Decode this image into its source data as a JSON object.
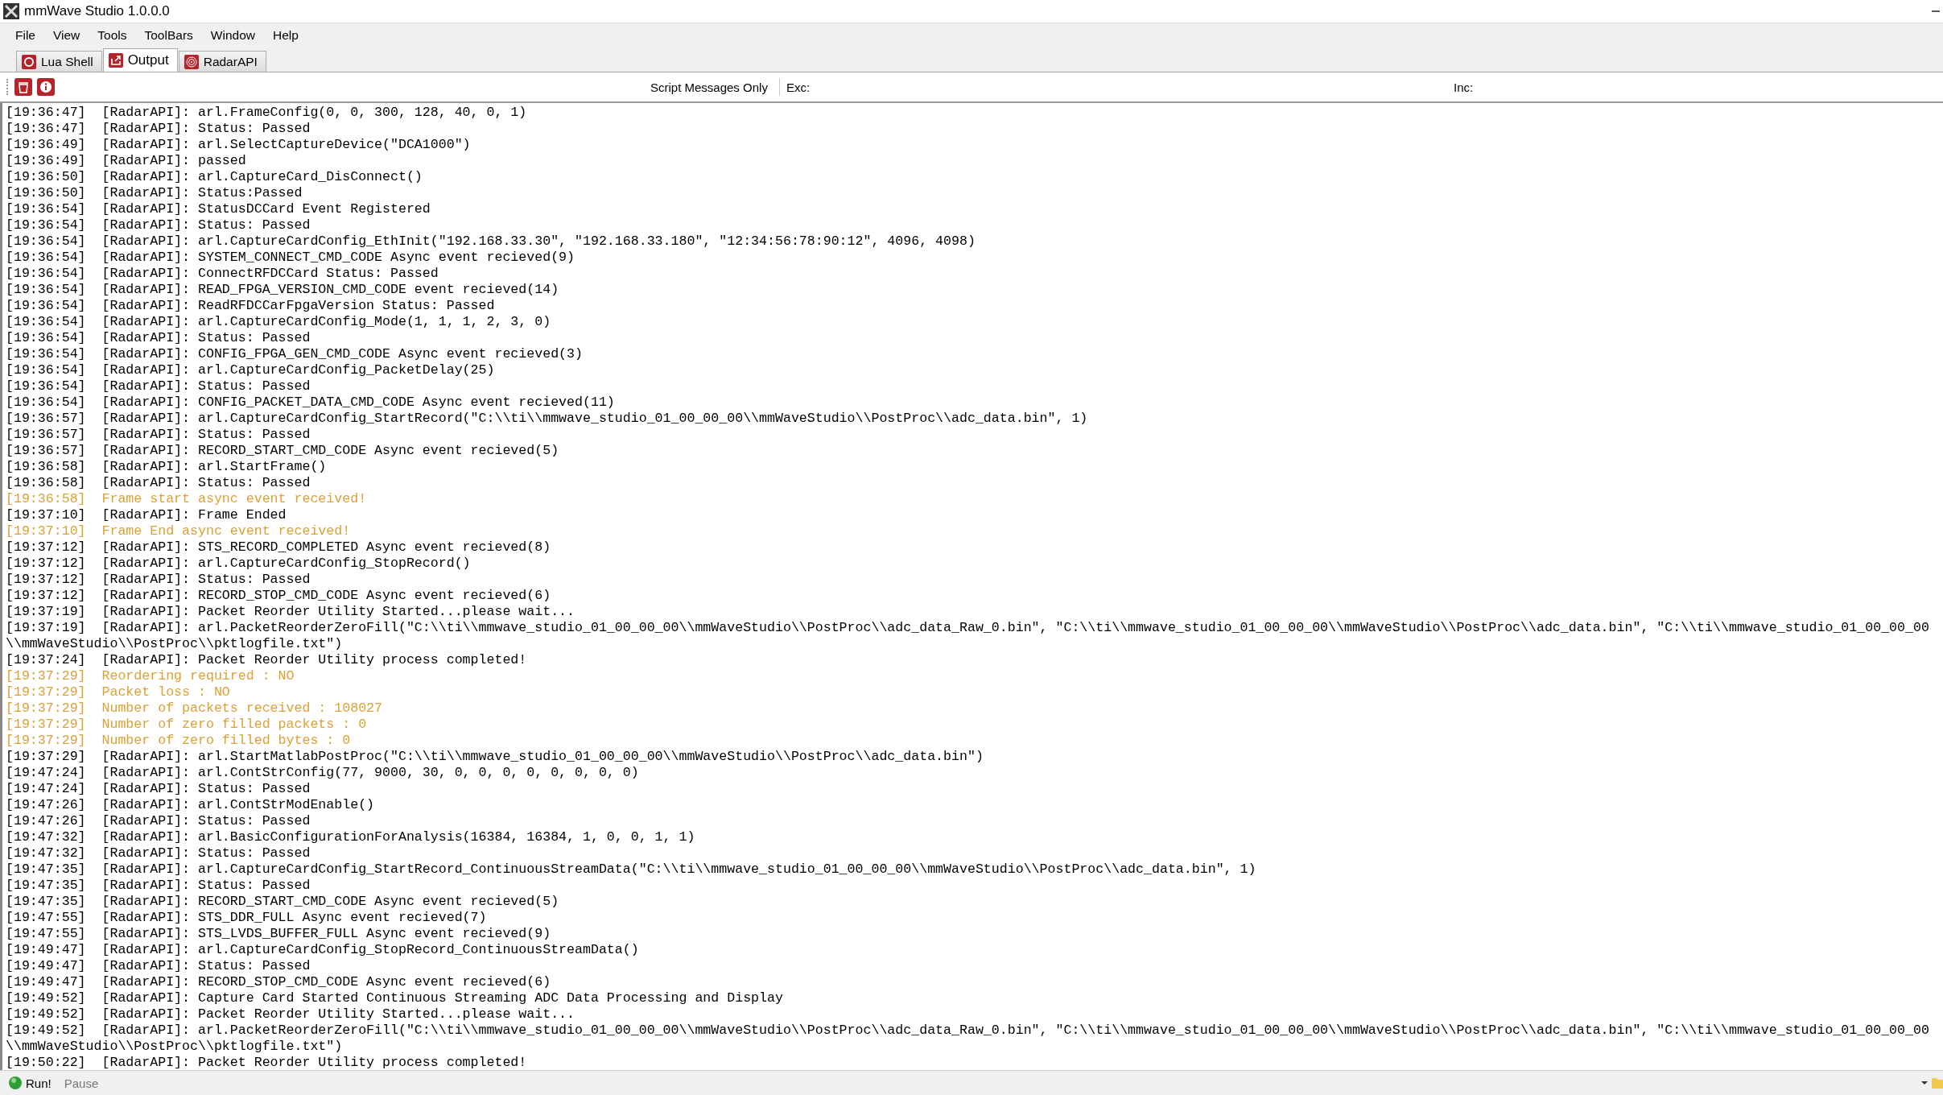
{
  "window": {
    "title": "mmWave Studio 1.0.0.0"
  },
  "menu": [
    "File",
    "View",
    "Tools",
    "ToolBars",
    "Window",
    "Help"
  ],
  "tabs": [
    {
      "label": "Lua Shell",
      "selected": false
    },
    {
      "label": "Output",
      "selected": true
    },
    {
      "label": "RadarAPI",
      "selected": false
    }
  ],
  "toolbar": {
    "filter_button": "Script Messages Only",
    "exclude_label": "Exc:",
    "include_label": "Inc:"
  },
  "log": [
    {
      "time": "[19:36:47]",
      "kind": "api",
      "text": "[RadarAPI]: arl.FrameConfig(0, 0, 300, 128, 40, 0, 1)"
    },
    {
      "time": "[19:36:47]",
      "kind": "api",
      "text": "[RadarAPI]: Status: Passed"
    },
    {
      "time": "[19:36:49]",
      "kind": "api",
      "text": "[RadarAPI]: arl.SelectCaptureDevice(\"DCA1000\")"
    },
    {
      "time": "[19:36:49]",
      "kind": "api",
      "text": "[RadarAPI]: passed"
    },
    {
      "time": "[19:36:50]",
      "kind": "api",
      "text": "[RadarAPI]: arl.CaptureCard_DisConnect()"
    },
    {
      "time": "[19:36:50]",
      "kind": "api",
      "text": "[RadarAPI]: Status:Passed"
    },
    {
      "time": "[19:36:54]",
      "kind": "api",
      "text": "[RadarAPI]: StatusDCCard Event Registered"
    },
    {
      "time": "[19:36:54]",
      "kind": "api",
      "text": "[RadarAPI]: Status: Passed"
    },
    {
      "time": "[19:36:54]",
      "kind": "api",
      "text": "[RadarAPI]: arl.CaptureCardConfig_EthInit(\"192.168.33.30\", \"192.168.33.180\", \"12:34:56:78:90:12\", 4096, 4098)"
    },
    {
      "time": "[19:36:54]",
      "kind": "api",
      "text": "[RadarAPI]: SYSTEM_CONNECT_CMD_CODE Async event recieved(9)"
    },
    {
      "time": "[19:36:54]",
      "kind": "api",
      "text": "[RadarAPI]: ConnectRFDCCard Status: Passed"
    },
    {
      "time": "[19:36:54]",
      "kind": "api",
      "text": "[RadarAPI]: READ_FPGA_VERSION_CMD_CODE event recieved(14)"
    },
    {
      "time": "[19:36:54]",
      "kind": "api",
      "text": "[RadarAPI]: ReadRFDCCarFpgaVersion Status: Passed"
    },
    {
      "time": "[19:36:54]",
      "kind": "api",
      "text": "[RadarAPI]: arl.CaptureCardConfig_Mode(1, 1, 1, 2, 3, 0)"
    },
    {
      "time": "[19:36:54]",
      "kind": "api",
      "text": "[RadarAPI]: Status: Passed"
    },
    {
      "time": "[19:36:54]",
      "kind": "api",
      "text": "[RadarAPI]: CONFIG_FPGA_GEN_CMD_CODE Async event recieved(3)"
    },
    {
      "time": "[19:36:54]",
      "kind": "api",
      "text": "[RadarAPI]: arl.CaptureCardConfig_PacketDelay(25)"
    },
    {
      "time": "[19:36:54]",
      "kind": "api",
      "text": "[RadarAPI]: Status: Passed"
    },
    {
      "time": "[19:36:54]",
      "kind": "api",
      "text": "[RadarAPI]: CONFIG_PACKET_DATA_CMD_CODE Async event recieved(11)"
    },
    {
      "time": "[19:36:57]",
      "kind": "api",
      "text": "[RadarAPI]: arl.CaptureCardConfig_StartRecord(\"C:\\\\ti\\\\mmwave_studio_01_00_00_00\\\\mmWaveStudio\\\\PostProc\\\\adc_data.bin\", 1)"
    },
    {
      "time": "[19:36:57]",
      "kind": "api",
      "text": "[RadarAPI]: Status: Passed"
    },
    {
      "time": "[19:36:57]",
      "kind": "api",
      "text": "[RadarAPI]: RECORD_START_CMD_CODE Async event recieved(5)"
    },
    {
      "time": "[19:36:58]",
      "kind": "api",
      "text": "[RadarAPI]: arl.StartFrame()"
    },
    {
      "time": "[19:36:58]",
      "kind": "api",
      "text": "[RadarAPI]: Status: Passed"
    },
    {
      "time": "[19:36:58]",
      "kind": "event",
      "text": "Frame start async event received!"
    },
    {
      "time": "[19:37:10]",
      "kind": "api",
      "text": "[RadarAPI]: Frame Ended"
    },
    {
      "time": "[19:37:10]",
      "kind": "event",
      "text": "Frame End async event received!"
    },
    {
      "time": "[19:37:12]",
      "kind": "api",
      "text": "[RadarAPI]: STS_RECORD_COMPLETED Async event recieved(8)"
    },
    {
      "time": "[19:37:12]",
      "kind": "api",
      "text": "[RadarAPI]: arl.CaptureCardConfig_StopRecord()"
    },
    {
      "time": "[19:37:12]",
      "kind": "api",
      "text": "[RadarAPI]: Status: Passed"
    },
    {
      "time": "[19:37:12]",
      "kind": "api",
      "text": "[RadarAPI]: RECORD_STOP_CMD_CODE Async event recieved(6)"
    },
    {
      "time": "[19:37:19]",
      "kind": "api",
      "text": "[RadarAPI]: Packet Reorder Utility Started...please wait..."
    },
    {
      "time": "[19:37:19]",
      "kind": "api",
      "text": "[RadarAPI]: arl.PacketReorderZeroFill(\"C:\\\\ti\\\\mmwave_studio_01_00_00_00\\\\mmWaveStudio\\\\PostProc\\\\adc_data_Raw_0.bin\", \"C:\\\\ti\\\\mmwave_studio_01_00_00_00\\\\mmWaveStudio\\\\PostProc\\\\adc_data.bin\", \"C:\\\\ti\\\\mmwave_studio_01_00_00_00\\\\mmWaveStudio\\\\PostProc\\\\pktlogfile.txt\")"
    },
    {
      "time": "[19:37:24]",
      "kind": "api",
      "text": "[RadarAPI]: Packet Reorder Utility process completed!"
    },
    {
      "time": "[19:37:29]",
      "kind": "event",
      "text": "Reordering required : NO"
    },
    {
      "time": "[19:37:29]",
      "kind": "event",
      "text": "Packet loss : NO"
    },
    {
      "time": "[19:37:29]",
      "kind": "event",
      "text": "Number of packets received : 108027"
    },
    {
      "time": "[19:37:29]",
      "kind": "event",
      "text": "Number of zero filled packets : 0"
    },
    {
      "time": "[19:37:29]",
      "kind": "event",
      "text": "Number of zero filled bytes : 0"
    },
    {
      "time": "[19:37:29]",
      "kind": "api",
      "text": "[RadarAPI]: arl.StartMatlabPostProc(\"C:\\\\ti\\\\mmwave_studio_01_00_00_00\\\\mmWaveStudio\\\\PostProc\\\\adc_data.bin\")"
    },
    {
      "time": "[19:47:24]",
      "kind": "api",
      "text": "[RadarAPI]: arl.ContStrConfig(77, 9000, 30, 0, 0, 0, 0, 0, 0, 0, 0)"
    },
    {
      "time": "[19:47:24]",
      "kind": "api",
      "text": "[RadarAPI]: Status: Passed"
    },
    {
      "time": "[19:47:26]",
      "kind": "api",
      "text": "[RadarAPI]: arl.ContStrModEnable()"
    },
    {
      "time": "[19:47:26]",
      "kind": "api",
      "text": "[RadarAPI]: Status: Passed"
    },
    {
      "time": "[19:47:32]",
      "kind": "api",
      "text": "[RadarAPI]: arl.BasicConfigurationForAnalysis(16384, 16384, 1, 0, 0, 1, 1)"
    },
    {
      "time": "[19:47:32]",
      "kind": "api",
      "text": "[RadarAPI]: Status: Passed"
    },
    {
      "time": "[19:47:35]",
      "kind": "api",
      "text": "[RadarAPI]: arl.CaptureCardConfig_StartRecord_ContinuousStreamData(\"C:\\\\ti\\\\mmwave_studio_01_00_00_00\\\\mmWaveStudio\\\\PostProc\\\\adc_data.bin\", 1)"
    },
    {
      "time": "[19:47:35]",
      "kind": "api",
      "text": "[RadarAPI]: Status: Passed"
    },
    {
      "time": "[19:47:35]",
      "kind": "api",
      "text": "[RadarAPI]: RECORD_START_CMD_CODE Async event recieved(5)"
    },
    {
      "time": "[19:47:55]",
      "kind": "api",
      "text": "[RadarAPI]: STS_DDR_FULL Async event recieved(7)"
    },
    {
      "time": "[19:47:55]",
      "kind": "api",
      "text": "[RadarAPI]: STS_LVDS_BUFFER_FULL Async event recieved(9)"
    },
    {
      "time": "[19:49:47]",
      "kind": "api",
      "text": "[RadarAPI]: arl.CaptureCardConfig_StopRecord_ContinuousStreamData()"
    },
    {
      "time": "[19:49:47]",
      "kind": "api",
      "text": "[RadarAPI]: Status: Passed"
    },
    {
      "time": "[19:49:47]",
      "kind": "api",
      "text": "[RadarAPI]: RECORD_STOP_CMD_CODE Async event recieved(6)"
    },
    {
      "time": "[19:49:52]",
      "kind": "api",
      "text": "[RadarAPI]: Capture Card Started Continuous Streaming ADC Data Processing and Display"
    },
    {
      "time": "[19:49:52]",
      "kind": "api",
      "text": "[RadarAPI]: Packet Reorder Utility Started...please wait..."
    },
    {
      "time": "[19:49:52]",
      "kind": "api",
      "text": "[RadarAPI]: arl.PacketReorderZeroFill(\"C:\\\\ti\\\\mmwave_studio_01_00_00_00\\\\mmWaveStudio\\\\PostProc\\\\adc_data_Raw_0.bin\", \"C:\\\\ti\\\\mmwave_studio_01_00_00_00\\\\mmWaveStudio\\\\PostProc\\\\adc_data.bin\", \"C:\\\\ti\\\\mmwave_studio_01_00_00_00\\\\mmWaveStudio\\\\PostProc\\\\pktlogfile.txt\")"
    },
    {
      "time": "[19:50:22]",
      "kind": "api",
      "text": "[RadarAPI]: Packet Reorder Utility process completed!"
    }
  ],
  "status_bar": {
    "run_button": "Run!",
    "pause_button": {
      "label": "Pause",
      "disabled": true
    }
  }
}
